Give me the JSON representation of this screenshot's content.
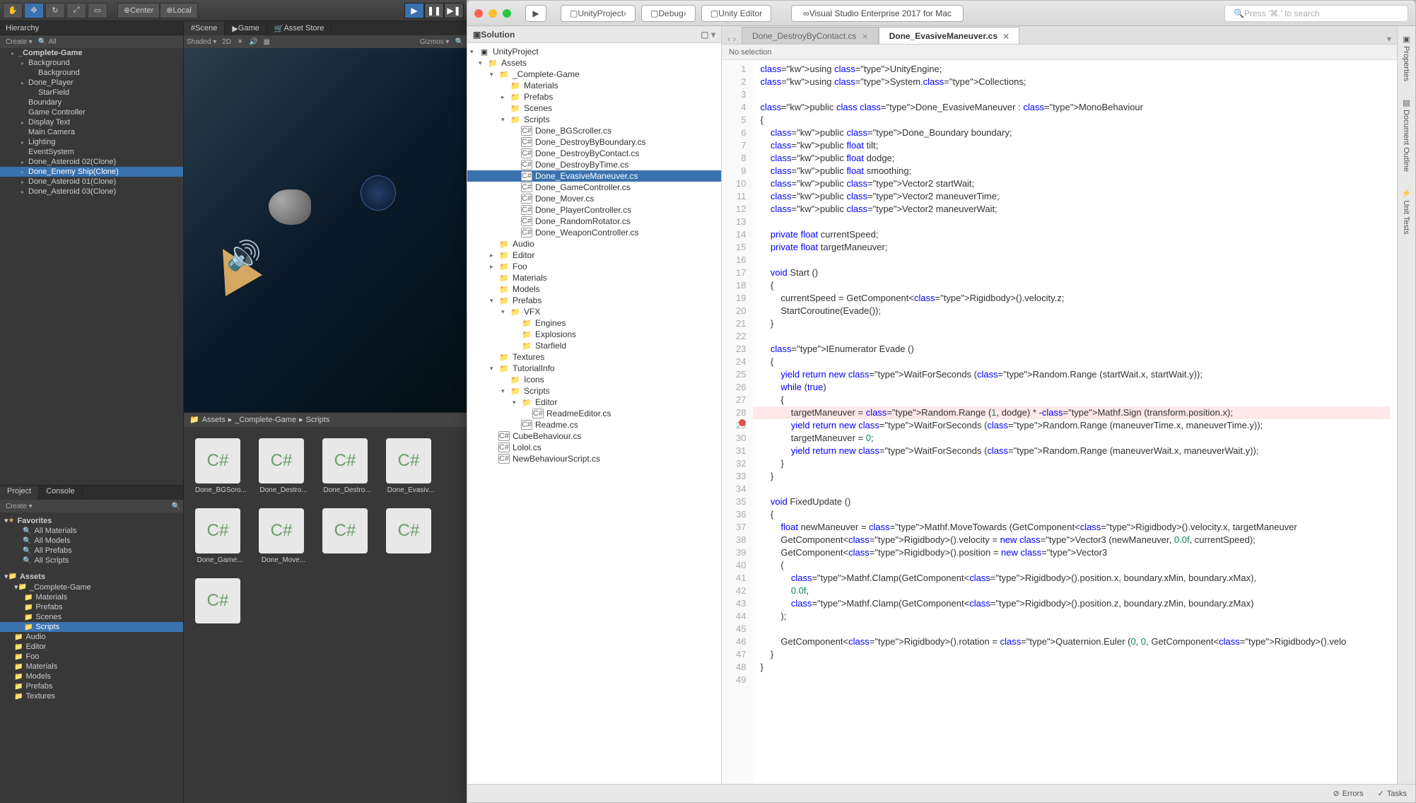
{
  "unity": {
    "toolbar": {
      "pivot1": "Center",
      "pivot2": "Local"
    },
    "hierarchy": {
      "tab": "Hierarchy",
      "create": "Create",
      "search": "All",
      "items": [
        {
          "name": "_Complete-Game",
          "bold": true,
          "arrow": true,
          "indent": 0
        },
        {
          "name": "Background",
          "arrow": true,
          "indent": 1
        },
        {
          "name": "Background",
          "indent": 2
        },
        {
          "name": "Done_Player",
          "arrow": true,
          "indent": 1
        },
        {
          "name": "StarField",
          "indent": 2
        },
        {
          "name": "Boundary",
          "indent": 1
        },
        {
          "name": "Game Controller",
          "indent": 1
        },
        {
          "name": "Display Text",
          "arrow": true,
          "indent": 1
        },
        {
          "name": "Main Camera",
          "indent": 1
        },
        {
          "name": "Lighting",
          "arrow": true,
          "indent": 1
        },
        {
          "name": "EventSystem",
          "indent": 1
        },
        {
          "name": "Done_Asteroid 02(Clone)",
          "arrow": true,
          "indent": 1
        },
        {
          "name": "Done_Enemy Ship(Clone)",
          "arrow": true,
          "indent": 1,
          "selected": true
        },
        {
          "name": "Done_Asteroid 01(Clone)",
          "arrow": true,
          "indent": 1
        },
        {
          "name": "Done_Asteroid 03(Clone)",
          "arrow": true,
          "indent": 1
        }
      ]
    },
    "scene_tabs": [
      "Scene",
      "Game",
      "Asset Store"
    ],
    "scene_toolbar": [
      "Shaded",
      "2D",
      "Gizmos"
    ],
    "project": {
      "tabs": [
        "Project",
        "Console"
      ],
      "create": "Create",
      "favorites_header": "Favorites",
      "favorites": [
        "All Materials",
        "All Models",
        "All Prefabs",
        "All Scripts"
      ],
      "assets_header": "Assets",
      "assets_tree": [
        {
          "name": "_Complete-Game",
          "indent": 1,
          "arrow": "down"
        },
        {
          "name": "Materials",
          "indent": 2
        },
        {
          "name": "Prefabs",
          "indent": 2
        },
        {
          "name": "Scenes",
          "indent": 2
        },
        {
          "name": "Scripts",
          "indent": 2,
          "selected": true
        },
        {
          "name": "Audio",
          "indent": 1
        },
        {
          "name": "Editor",
          "indent": 1
        },
        {
          "name": "Foo",
          "indent": 1
        },
        {
          "name": "Materials",
          "indent": 1
        },
        {
          "name": "Models",
          "indent": 1
        },
        {
          "name": "Prefabs",
          "indent": 1
        },
        {
          "name": "Textures",
          "indent": 1
        }
      ]
    },
    "breadcrumb": [
      "Assets",
      "_Complete-Game",
      "Scripts"
    ],
    "assets": [
      "Done_BGScro...",
      "Done_Destro...",
      "Done_Destro...",
      "Done_Evasiv...",
      "Done_Game...",
      "Done_Move..."
    ]
  },
  "vs": {
    "targets": [
      "UnityProject",
      "Debug",
      "Unity Editor"
    ],
    "title": "Visual Studio Enterprise 2017 for Mac",
    "search_placeholder": "Press '⌘.' to search",
    "solution": {
      "header": "Solution",
      "tree": [
        {
          "name": "UnityProject",
          "depth": 0,
          "icon": "sln",
          "arrow": "down"
        },
        {
          "name": "Assets",
          "depth": 1,
          "icon": "folder",
          "arrow": "down"
        },
        {
          "name": "_Complete-Game",
          "depth": 2,
          "icon": "folder",
          "arrow": "down"
        },
        {
          "name": "Materials",
          "depth": 3,
          "icon": "folder"
        },
        {
          "name": "Prefabs",
          "depth": 3,
          "icon": "folder",
          "arrow": "right"
        },
        {
          "name": "Scenes",
          "depth": 3,
          "icon": "folder"
        },
        {
          "name": "Scripts",
          "depth": 3,
          "icon": "folder",
          "arrow": "down"
        },
        {
          "name": "Done_BGScroller.cs",
          "depth": 4,
          "icon": "cs"
        },
        {
          "name": "Done_DestroyByBoundary.cs",
          "depth": 4,
          "icon": "cs"
        },
        {
          "name": "Done_DestroyByContact.cs",
          "depth": 4,
          "icon": "cs"
        },
        {
          "name": "Done_DestroyByTime.cs",
          "depth": 4,
          "icon": "cs"
        },
        {
          "name": "Done_EvasiveManeuver.cs",
          "depth": 4,
          "icon": "cs",
          "selected": true
        },
        {
          "name": "Done_GameController.cs",
          "depth": 4,
          "icon": "cs"
        },
        {
          "name": "Done_Mover.cs",
          "depth": 4,
          "icon": "cs"
        },
        {
          "name": "Done_PlayerController.cs",
          "depth": 4,
          "icon": "cs"
        },
        {
          "name": "Done_RandomRotator.cs",
          "depth": 4,
          "icon": "cs"
        },
        {
          "name": "Done_WeaponController.cs",
          "depth": 4,
          "icon": "cs"
        },
        {
          "name": "Audio",
          "depth": 2,
          "icon": "folder"
        },
        {
          "name": "Editor",
          "depth": 2,
          "icon": "folder",
          "arrow": "right"
        },
        {
          "name": "Foo",
          "depth": 2,
          "icon": "folder",
          "arrow": "right"
        },
        {
          "name": "Materials",
          "depth": 2,
          "icon": "folder"
        },
        {
          "name": "Models",
          "depth": 2,
          "icon": "folder"
        },
        {
          "name": "Prefabs",
          "depth": 2,
          "icon": "folder",
          "arrow": "down"
        },
        {
          "name": "VFX",
          "depth": 3,
          "icon": "folder",
          "arrow": "down"
        },
        {
          "name": "Engines",
          "depth": 4,
          "icon": "folder"
        },
        {
          "name": "Explosions",
          "depth": 4,
          "icon": "folder"
        },
        {
          "name": "Starfield",
          "depth": 4,
          "icon": "folder"
        },
        {
          "name": "Textures",
          "depth": 2,
          "icon": "folder"
        },
        {
          "name": "TutorialInfo",
          "depth": 2,
          "icon": "folder",
          "arrow": "down"
        },
        {
          "name": "Icons",
          "depth": 3,
          "icon": "folder"
        },
        {
          "name": "Scripts",
          "depth": 3,
          "icon": "folder",
          "arrow": "down"
        },
        {
          "name": "Editor",
          "depth": 4,
          "icon": "folder",
          "arrow": "down"
        },
        {
          "name": "ReadmeEditor.cs",
          "depth": 5,
          "icon": "cs"
        },
        {
          "name": "Readme.cs",
          "depth": 4,
          "icon": "cs"
        },
        {
          "name": "CubeBehaviour.cs",
          "depth": 2,
          "icon": "cs"
        },
        {
          "name": "Lolol.cs",
          "depth": 2,
          "icon": "cs"
        },
        {
          "name": "NewBehaviourScript.cs",
          "depth": 2,
          "icon": "cs"
        }
      ]
    },
    "tabs": [
      {
        "label": "Done_DestroyByContact.cs",
        "active": false
      },
      {
        "label": "Done_EvasiveManeuver.cs",
        "active": true
      }
    ],
    "breadcrumb": "No selection",
    "side_tabs": [
      "Properties",
      "Document Outline",
      "Unit Tests"
    ],
    "status": {
      "errors": "Errors",
      "tasks": "Tasks"
    },
    "code": {
      "breakpoint_line": 28,
      "lines": [
        "using UnityEngine;",
        "using System.Collections;",
        "",
        "public class Done_EvasiveManeuver : MonoBehaviour",
        "{",
        "    public Done_Boundary boundary;",
        "    public float tilt;",
        "    public float dodge;",
        "    public float smoothing;",
        "    public Vector2 startWait;",
        "    public Vector2 maneuverTime;",
        "    public Vector2 maneuverWait;",
        "",
        "    private float currentSpeed;",
        "    private float targetManeuver;",
        "",
        "    void Start ()",
        "    {",
        "        currentSpeed = GetComponent<Rigidbody>().velocity.z;",
        "        StartCoroutine(Evade());",
        "    }",
        "",
        "    IEnumerator Evade ()",
        "    {",
        "        yield return new WaitForSeconds (Random.Range (startWait.x, startWait.y));",
        "        while (true)",
        "        {",
        "            targetManeuver = Random.Range (1, dodge) * -Mathf.Sign (transform.position.x);",
        "            yield return new WaitForSeconds (Random.Range (maneuverTime.x, maneuverTime.y));",
        "            targetManeuver = 0;",
        "            yield return new WaitForSeconds (Random.Range (maneuverWait.x, maneuverWait.y));",
        "        }",
        "    }",
        "",
        "    void FixedUpdate ()",
        "    {",
        "        float newManeuver = Mathf.MoveTowards (GetComponent<Rigidbody>().velocity.x, targetManeuver",
        "        GetComponent<Rigidbody>().velocity = new Vector3 (newManeuver, 0.0f, currentSpeed);",
        "        GetComponent<Rigidbody>().position = new Vector3",
        "        (",
        "            Mathf.Clamp(GetComponent<Rigidbody>().position.x, boundary.xMin, boundary.xMax),",
        "            0.0f,",
        "            Mathf.Clamp(GetComponent<Rigidbody>().position.z, boundary.zMin, boundary.zMax)",
        "        );",
        "",
        "        GetComponent<Rigidbody>().rotation = Quaternion.Euler (0, 0, GetComponent<Rigidbody>().velo",
        "    }",
        "}",
        ""
      ]
    }
  }
}
